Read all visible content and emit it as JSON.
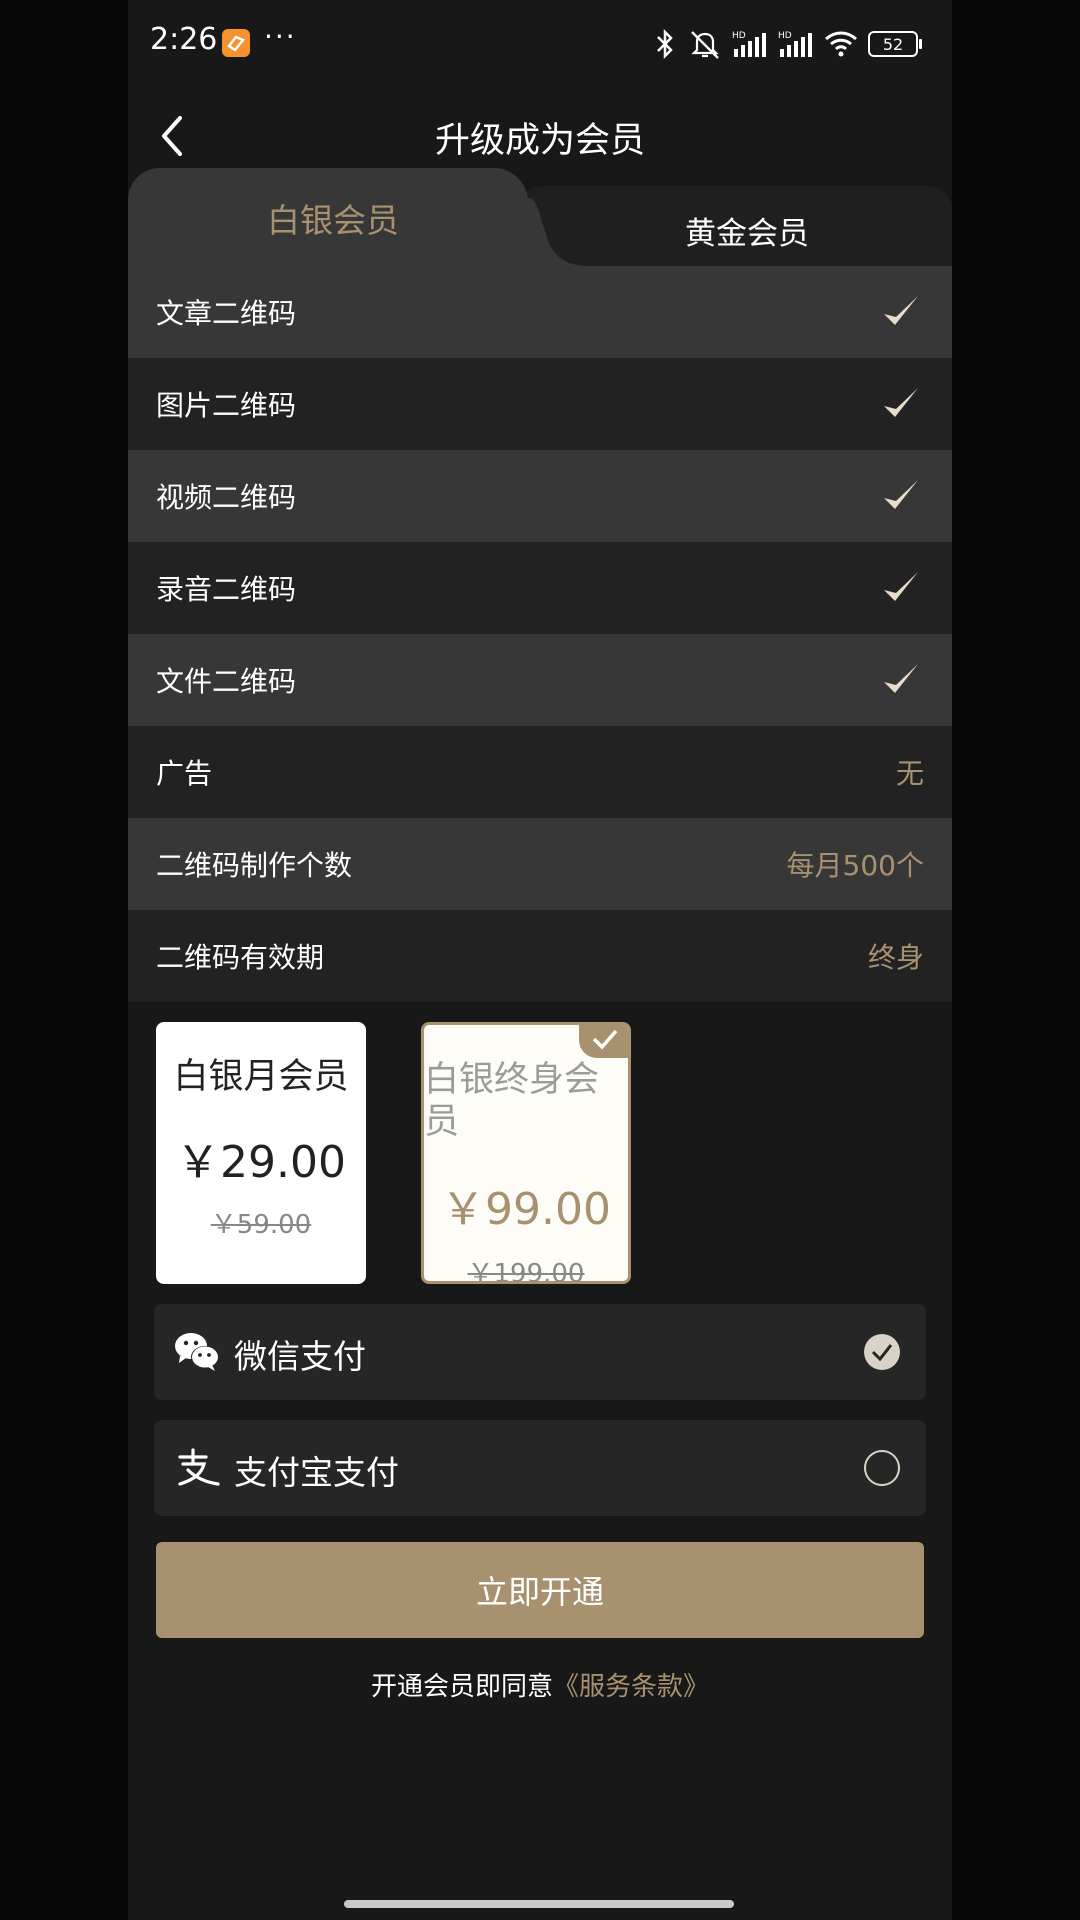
{
  "status_bar": {
    "time": "2:26",
    "more": "···",
    "battery": "52",
    "icons": [
      "app-icon",
      "bluetooth-icon",
      "mute-icon",
      "signal-icon",
      "signal-icon",
      "wifi-icon",
      "battery-icon"
    ]
  },
  "header": {
    "title": "升级成为会员",
    "back_icon": "chevron-left-icon"
  },
  "tabs": [
    {
      "label": "白银会员",
      "active": true
    },
    {
      "label": "黄金会员",
      "active": false
    }
  ],
  "features": [
    {
      "label": "文章二维码",
      "type": "check"
    },
    {
      "label": "图片二维码",
      "type": "check"
    },
    {
      "label": "视频二维码",
      "type": "check"
    },
    {
      "label": "录音二维码",
      "type": "check"
    },
    {
      "label": "文件二维码",
      "type": "check"
    },
    {
      "label": "广告",
      "value": "无"
    },
    {
      "label": "二维码制作个数",
      "value": "每月500个"
    },
    {
      "label": "二维码有效期",
      "value": "终身"
    }
  ],
  "plans": [
    {
      "name": "白银月会员",
      "price": "￥29.00",
      "original_price": "￥59.00",
      "selected": false
    },
    {
      "name": "白银终身会员",
      "price": "￥99.00",
      "original_price": "￥199.00",
      "selected": true
    }
  ],
  "payment": [
    {
      "label": "微信支付",
      "icon": "wechat-icon",
      "selected": true
    },
    {
      "label": "支付宝支付",
      "icon": "alipay-icon",
      "selected": false
    }
  ],
  "cta": {
    "label": "立即开通"
  },
  "agreement": {
    "prefix": "开通会员即同意",
    "link": "《服务条款》"
  },
  "colors": {
    "accent": "#a8916f",
    "background": "#181818",
    "row_light": "#373737",
    "row_dark": "#222222"
  }
}
